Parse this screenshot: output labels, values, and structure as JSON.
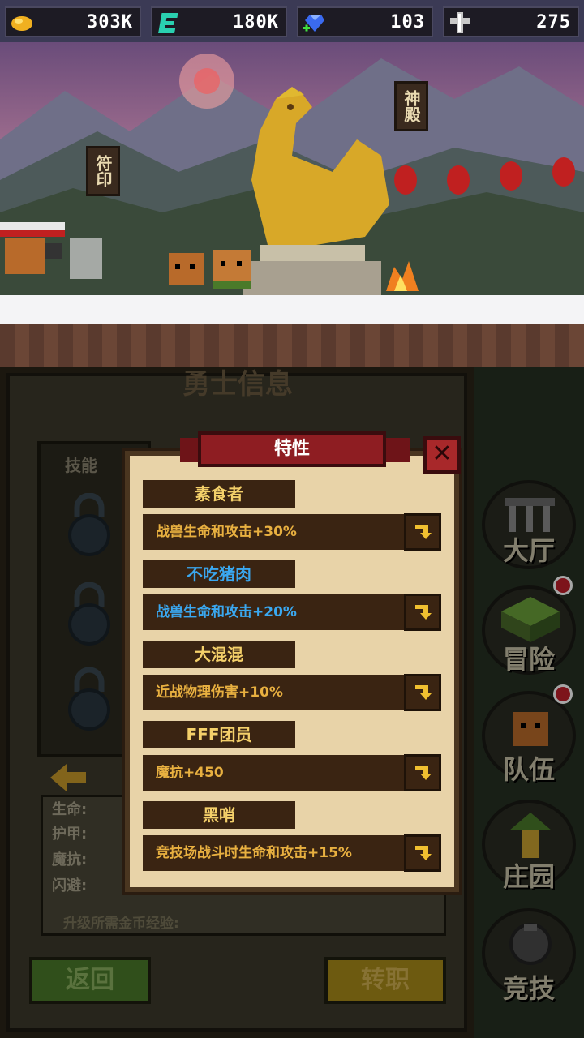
{
  "resources": [
    {
      "name": "gold",
      "icon": "gold-nugget-icon",
      "value": "303K"
    },
    {
      "name": "exp",
      "icon": "green-e-icon",
      "value": "180K"
    },
    {
      "name": "gems",
      "icon": "blue-gem-icon",
      "value": "103"
    },
    {
      "name": "medals",
      "icon": "silver-cross-icon",
      "value": "275"
    }
  ],
  "scene": {
    "sign_left": "符印",
    "sign_right": "神殿"
  },
  "panel": {
    "title": "勇士信息",
    "skills_label": "技能",
    "stats": [
      "生命:",
      "护甲:",
      "魔抗:",
      "闪避:"
    ],
    "upgrade_label": "升级所需金币经验:",
    "back_label": "返回",
    "job_label": "转职"
  },
  "nav": [
    {
      "label": "大厅",
      "icon": "hall-icon",
      "dot": false
    },
    {
      "label": "冒险",
      "icon": "adventure-icon",
      "dot": true
    },
    {
      "label": "队伍",
      "icon": "team-icon",
      "dot": true
    },
    {
      "label": "庄园",
      "icon": "manor-icon",
      "dot": false
    },
    {
      "label": "竞技",
      "icon": "arena-icon",
      "dot": false
    }
  ],
  "modal": {
    "title": "特性",
    "close": "✕",
    "traits": [
      {
        "name": "素食者",
        "name_color": "#f4d06a",
        "desc": "战兽生命和攻击+30%",
        "desc_color": "#e8b040"
      },
      {
        "name": "不吃猪肉",
        "name_color": "#3aa8f0",
        "desc": "战兽生命和攻击+20%",
        "desc_color": "#3aa8f0"
      },
      {
        "name": "大混混",
        "name_color": "#f4d06a",
        "desc": "近战物理伤害+10%",
        "desc_color": "#e8b040"
      },
      {
        "name": "FFF团员",
        "name_color": "#f4d06a",
        "desc": "魔抗+450",
        "desc_color": "#e8b040"
      },
      {
        "name": "黑哨",
        "name_color": "#f4d06a",
        "desc": "竞技场战斗时生命和攻击+15%",
        "desc_color": "#e8b040"
      }
    ]
  }
}
